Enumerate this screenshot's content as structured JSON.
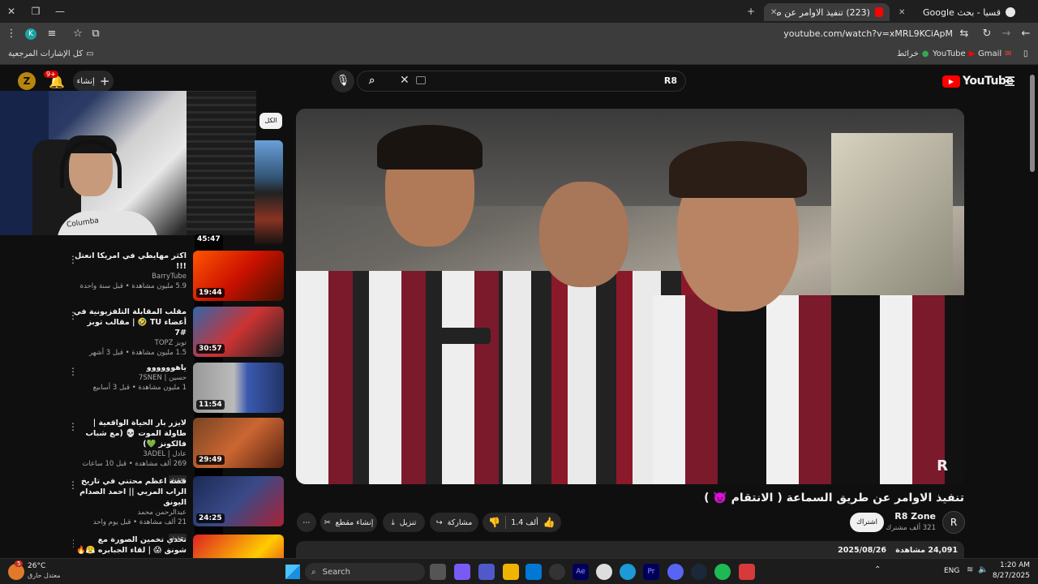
{
  "browser": {
    "tabs": [
      {
        "label": "(223) تنفيذ الاوامر عن طريق",
        "active": true
      },
      {
        "label": "قسيا - بحث Google",
        "active": false
      }
    ],
    "url": "youtube.com/watch?v=xMRL9KCiApM",
    "profile_initial": "K",
    "bookmarks": {
      "all": "كل الإشارات المرجعية",
      "gmail": "Gmail",
      "youtube": "YouTube",
      "maps": "خرائط"
    }
  },
  "youtube": {
    "logo": "YouTube",
    "search_value": "R8",
    "create_label": "إنشاء",
    "notif_count": "9+",
    "filter_chip": "الكل"
  },
  "sidebar": {
    "items": [
      {
        "title": "",
        "channel": "",
        "meta": "",
        "duration": "45:47",
        "badge": ""
      },
      {
        "title": "اكثر مهايطي في امريكا انعتل !!!",
        "channel": "BarryTube",
        "meta": "5.9 مليون مشاهدة • قبل سنة واحدة",
        "duration": "19:44",
        "badge": ""
      },
      {
        "title": "مقلب المقابلة التلفزيونية في أعضاء TU 🤣 | مقالب توبز #7",
        "channel": "توبز TOPZ",
        "meta": "1.5 مليون مشاهدة • قبل 3 أشهر",
        "duration": "30:57",
        "badge": ""
      },
      {
        "title": "ياهوووووو",
        "channel": "حسين | 7SNEN",
        "meta": "1 مليون مشاهدة • قبل 3 أسابيع",
        "duration": "11:54",
        "badge": ""
      },
      {
        "title": "لايزر بار الحياة الواقعية | طاولة الموت 💀 (مع شباب فالكونز 💚)",
        "channel": "عادل | 3ADEL",
        "meta": "269 ألف مشاهدة • قبل 10 ساعات",
        "duration": "29:49",
        "badge": "جديد"
      },
      {
        "title": "قصة اعظم محتني في تاريخ الراب المربي || احمد الصدام اليونق",
        "channel": "عبدالرحمن محمد",
        "meta": "21 ألف مشاهدة • قبل يوم واحد",
        "duration": "24:25",
        "badge": "جديد"
      },
      {
        "title": "تحدي تخمين الصورة مع شونق 😱 | لقاء الجبابره 😤🔥",
        "channel": "",
        "meta": "",
        "duration": "",
        "badge": ""
      }
    ]
  },
  "video": {
    "title": "تنفيذ الاوامر عن طريق السماعة ( الانتقام 👿 )",
    "channel": "R8 Zone",
    "subscribers": "321 ألف مشترك",
    "subscribe": "اشتراك",
    "likes": "1.4 ألف",
    "share": "مشاركة",
    "download": "تنزيل",
    "clip": "إنشاء مقطع",
    "views": "24,091 مشاهدة",
    "date": "2025/08/26"
  },
  "taskbar": {
    "weather_temp": "26°C",
    "weather_desc": "معتدل حارق",
    "search": "Search",
    "lang": "ENG",
    "time": "1:20 AM",
    "date": "8/27/2025",
    "notif": "5"
  },
  "colors": {
    "red": "#ff0000",
    "bg": "#0f0f0f",
    "chip": "#272727"
  }
}
